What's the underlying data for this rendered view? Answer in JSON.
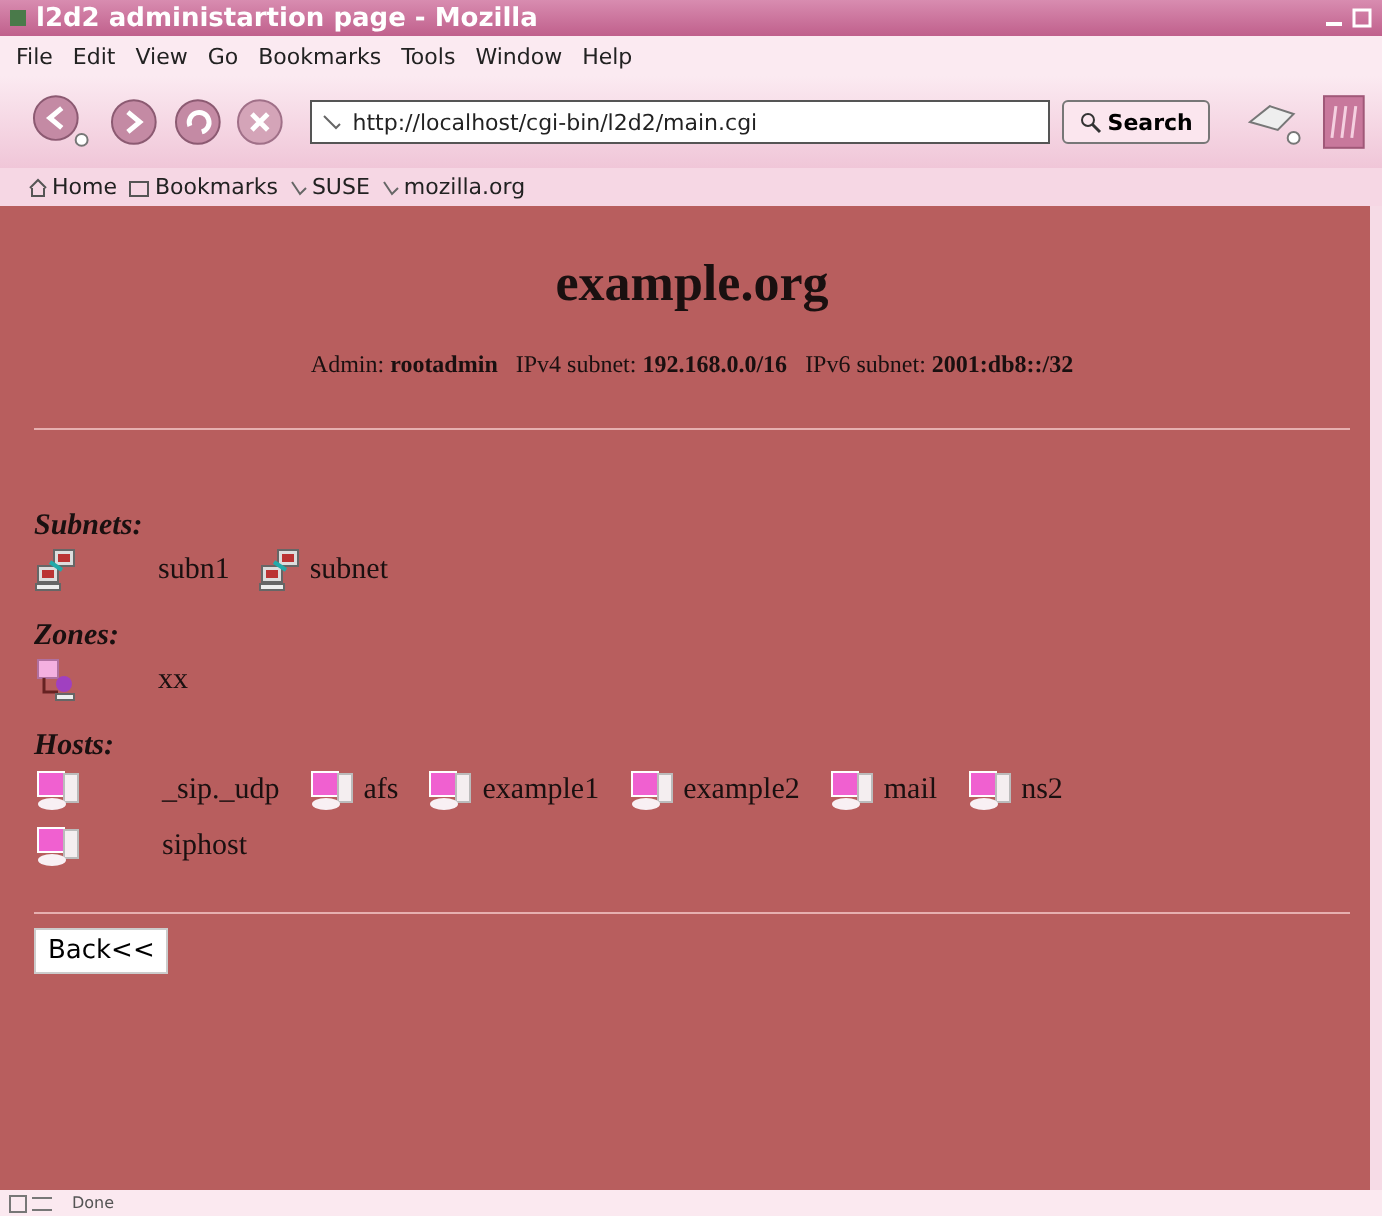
{
  "window": {
    "title": "l2d2 administartion page - Mozilla"
  },
  "menu": [
    "File",
    "Edit",
    "View",
    "Go",
    "Bookmarks",
    "Tools",
    "Window",
    "Help"
  ],
  "address": {
    "value": "http://localhost/cgi-bin/l2d2/main.cgi"
  },
  "search_button": "Search",
  "bookmarks": [
    {
      "kind": "home",
      "label": "Home"
    },
    {
      "kind": "folder",
      "label": "Bookmarks"
    },
    {
      "kind": "link",
      "label": "SUSE"
    },
    {
      "kind": "link",
      "label": "mozilla.org"
    }
  ],
  "page": {
    "heading": "example.org",
    "info": "Admin: **rootadmin**   IPv4 subnet: **192.168.0.0/16**   IPv6 subnet: **2001:db8::/32**",
    "sections": [
      {
        "title": "Subnets:",
        "kind": "subnet",
        "items": [
          "subn1",
          "subnet"
        ]
      },
      {
        "title": "Zones:",
        "kind": "zone",
        "items": [
          "xx"
        ]
      },
      {
        "title": "Hosts:",
        "kind": "host",
        "items": [
          "_sip._udp",
          "afs",
          "example1",
          "example2",
          "mail",
          "ns2",
          "siphost"
        ]
      }
    ],
    "back_button": "Back<<"
  },
  "status_bar": "Done"
}
